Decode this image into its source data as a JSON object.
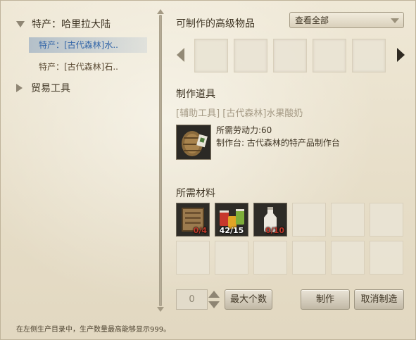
{
  "tree": {
    "category_1": "特产：哈里拉大陆",
    "sub_items": [
      "特产：[古代森林]水..",
      "特产：[古代森林]石.."
    ],
    "category_2": "贸易工具"
  },
  "craftable": {
    "title": "可制作的高级物品",
    "filter_selected": "查看全部"
  },
  "tool": {
    "section_title": "制作道具",
    "tags": "[辅助工具] [古代森林]水果酸奶",
    "labor": "所需劳动力:60",
    "station": "制作台: 古代森林的特产品制作台",
    "icon": "crate-item-icon"
  },
  "materials": {
    "section_title": "所需材料",
    "filled": [
      {
        "icon": "tablet-icon",
        "count": "0/4",
        "status": "insufficient"
      },
      {
        "icon": "fruit-jars-icon",
        "count": "42/15",
        "status": "sufficient"
      },
      {
        "icon": "milk-bottle-icon",
        "count": "0/10",
        "status": "insufficient"
      }
    ]
  },
  "controls": {
    "quantity": "0",
    "max_button": "最大个数",
    "craft_button": "制作",
    "cancel_button": "取消制造"
  },
  "hint": "在左侧生产目录中，生产数量最高能够显示999。"
}
